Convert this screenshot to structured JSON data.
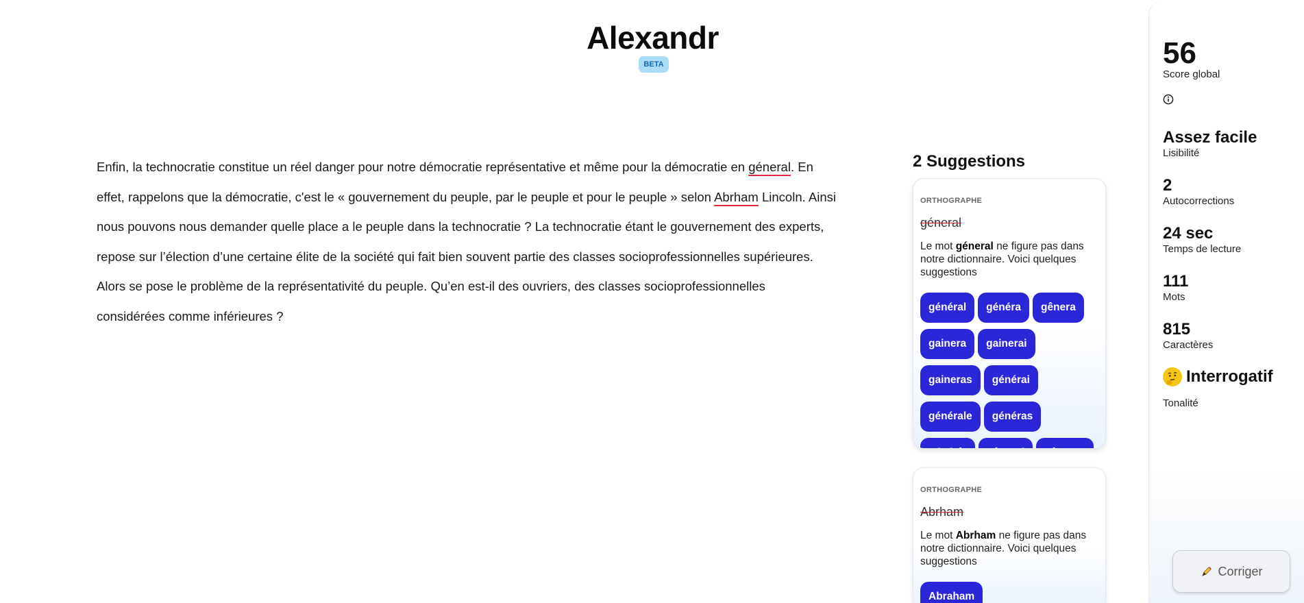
{
  "header": {
    "title": "Alexandr",
    "badge": "BETA"
  },
  "editor": {
    "p1": "Enfin, la technocratie constitue un réel danger pour notre démocratie représentative et même pour la démocratie en ",
    "err1": "géneral",
    "p2": ". En effet, rappelons que la démocratie, c'est le « gouvernement du peuple, par le peuple et pour le peuple » selon ",
    "err2": "Abrham",
    "p3": " Lincoln. Ainsi nous pouvons nous demander quelle place a le peuple dans la technocratie ? La technocratie étant le gouvernement des experts, repose sur l’élection d’une certaine élite de la société qui fait bien souvent partie des classes socioprofessionnelles supérieures. Alors se pose le problème de la représentativité du peuple. Qu’en est-il des ouvriers, des classes socioprofessionnelles considérées comme inférieures ?"
  },
  "suggestions": {
    "title": "2 Suggestions",
    "cards": [
      {
        "category": "ORTHOGRAPHE",
        "word": "géneral",
        "msg_before": "Le mot ",
        "msg_word": "géneral",
        "msg_after": " ne figure pas dans notre dictionnaire. Voici quelques suggestions",
        "options": [
          "général",
          "généra",
          "gênera",
          "gainera",
          "gainerai",
          "gaineras",
          "générai",
          "générale",
          "généras",
          "générât",
          "gênerai",
          "gêneras"
        ]
      },
      {
        "category": "ORTHOGRAPHE",
        "word": "Abrham",
        "msg_before": "Le mot ",
        "msg_word": "Abrham",
        "msg_after": " ne figure pas dans notre dictionnaire. Voici quelques suggestions",
        "options": [
          "Abraham"
        ]
      }
    ]
  },
  "stats": {
    "score_value": "56",
    "score_label": "Score global",
    "readability_value": "Assez facile",
    "readability_label": "Lisibilité",
    "autocorrections_value": "2",
    "autocorrections_label": "Autocorrections",
    "reading_time_value": "24 sec",
    "reading_time_label": "Temps de lecture",
    "words_value": "111",
    "words_label": "Mots",
    "chars_value": "815",
    "chars_label": "Caractères",
    "tone_value": "Interrogatif",
    "tone_label": "Tonalité",
    "tone_icon": "thinking-face-emoji"
  },
  "actions": {
    "fix_label": "Corriger",
    "fix_icon": "pen-icon"
  },
  "colors": {
    "chip": "#2b27d9",
    "error_underline": "#e3263a",
    "badge_bg": "#a9dcf7",
    "badge_text": "#1268b8"
  }
}
